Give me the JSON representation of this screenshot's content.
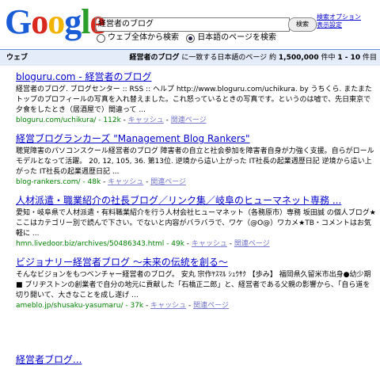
{
  "logo": {
    "text": [
      "G",
      "o",
      "o",
      "g",
      "l",
      "e"
    ],
    "colors": [
      "#1a5bd6",
      "#d9281d",
      "#f0b400",
      "#1a5bd6",
      "#2a9d2a",
      "#d9281d"
    ]
  },
  "search": {
    "query": "経営者のブログ",
    "button": "検索",
    "adv_link": "検索オプション",
    "pref_link": "表示設定"
  },
  "radios": [
    {
      "label": "ウェブ全体から検索",
      "checked": false
    },
    {
      "label": "日本語のページを検索",
      "checked": true
    }
  ],
  "bar": {
    "tab": "ウェブ",
    "summary_query": "経営者のブログ",
    "summary_mid": " に一致する日本語のページ 約 ",
    "summary_count": "1,500,000",
    "summary_tail": " 件中 ",
    "summary_range": "1 - 10",
    "summary_end": " 件目"
  },
  "results": [
    {
      "title": "bloguru.com - 経営者のブログ",
      "snippet": "経営者のブログ. ブログセンター :: RSS :: ヘルプ http://www.bloguru.com/uchikura. by うちくら. またまたトップのプロフィールの写真を入れ替えました。これ怒っているときの写真です。というのは嘘で、先日東京で夕食をしたとき（居酒屋で）間違って ...",
      "url": "bloguru.com/uchikura/",
      "size": "112k",
      "cache": "キャッシュ",
      "related": "関連ページ"
    },
    {
      "title": "経営ブログランカーズ \"Management Blog Rankers\"",
      "snippet": "聴覚障害のパソコンスクール経営者のブログ 障害者の自立と社会参加を障害者自身が力強く支援。自らがロールモデルとなって活躍。 20, 12, 105, 36. 第13位. 逆境から這い上がった IT社長の起業週歴日記 逆境から這い上がった IT社長の起業週歴日記 ...",
      "url": "blog-rankers.com/",
      "size": "48k",
      "cache": "キャッシュ",
      "related": "関連ページ"
    },
    {
      "title": "人材派遣・職業紹介の社長ブログ／リンク集／岐阜のヒューマネット専務 ...",
      "snippet": "愛知・岐阜県で人材派遣・有料職業紹介を行う人材会社ヒューマネット（各務原市）専務 坂田誠 の個人ブログ★ここはカテゴリー別で読んで下さい。でないと内容がバラバラで、ワケ（@O@）ワカメ★TB・コメントはお気軽に ...",
      "url": "hmn.livedoor.biz/archives/50486343.html",
      "size": "49k",
      "cache": "キャッシュ",
      "related": "関連ページ"
    },
    {
      "title": "ビジョナリー経営者ブログ 〜未来の伝統を創る〜",
      "snippet": "そんなビジョンをもつベンチャー経営者のブログ。 安丸 宗作ﾔｽﾏﾙ ｼｭｳｻｸ 【歩み】 福岡県久留米市出身●幼少期■ ブリヂストンの創業者で自分の地元に貢献した「石橋正二郎」と、経営者である父親の影響から、「自ら道を切り開いて、大きなことを成し遂げ ...",
      "url": "ameblo.jp/shusaku-yasumaru/",
      "size": "37k",
      "cache": "キャッシュ",
      "related": "関連ページ"
    }
  ],
  "partial_title": "経営者ブログ..."
}
